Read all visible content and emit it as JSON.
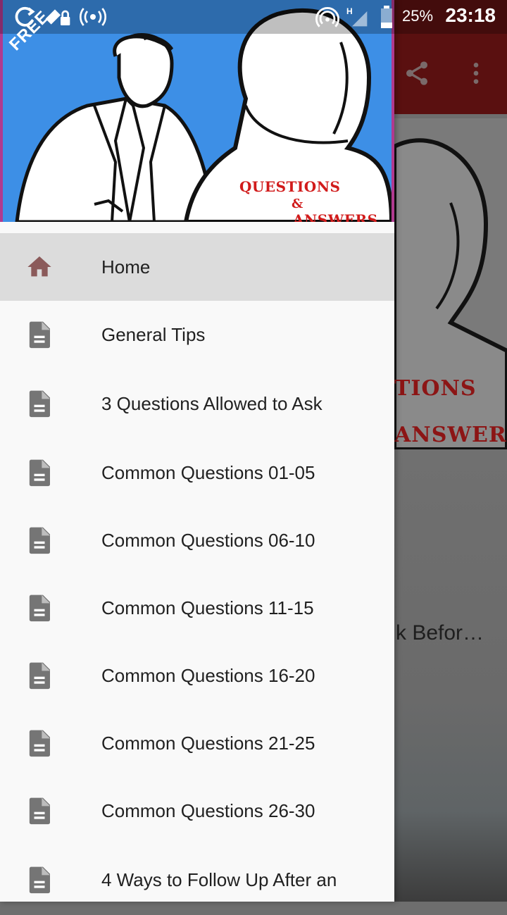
{
  "status_bar": {
    "battery_percent": "25%",
    "time": "23:18",
    "network_type": "H"
  },
  "header": {
    "badge": "FREE",
    "image_text_line1": "QUESTIONS",
    "image_text_line2": "&",
    "image_text_line3": "ANSWERS"
  },
  "background": {
    "hero_text_line1": "TIONS",
    "hero_text_line2": "ANSWER",
    "card_title_fragment": "k Befor…"
  },
  "nav": {
    "items": [
      {
        "label": "Home",
        "icon": "home-icon",
        "active": true
      },
      {
        "label": "General Tips",
        "icon": "document-icon"
      },
      {
        "label": "3 Questions Allowed to Ask",
        "icon": "document-icon"
      },
      {
        "label": "Common Questions 01-05",
        "icon": "document-icon"
      },
      {
        "label": "Common Questions 06-10",
        "icon": "document-icon"
      },
      {
        "label": "Common Questions 11-15",
        "icon": "document-icon"
      },
      {
        "label": "Common Questions 16-20",
        "icon": "document-icon"
      },
      {
        "label": "Common Questions 21-25",
        "icon": "document-icon"
      },
      {
        "label": "Common Questions 26-30",
        "icon": "document-icon"
      },
      {
        "label": "4 Ways to Follow Up After an",
        "icon": "document-icon"
      }
    ]
  },
  "colors": {
    "accent": "#8b5a5a",
    "toolbar": "#5a1010",
    "header_bg": "#3d8fe6",
    "header_text": "#d11b1b"
  }
}
